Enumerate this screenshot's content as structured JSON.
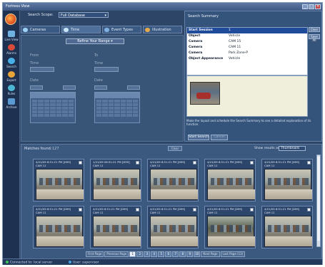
{
  "window": {
    "title": "Fortress View"
  },
  "sidebar": {
    "items": [
      {
        "label": "Live View",
        "icon": "monitor-icon",
        "color": "#6fb2e0"
      },
      {
        "label": "Alarms",
        "icon": "alarm-icon",
        "color": "#d94a3a"
      },
      {
        "label": "Search",
        "icon": "search-icon",
        "color": "#4ab0e8"
      },
      {
        "label": "Export",
        "icon": "export-icon",
        "color": "#e8a43a"
      },
      {
        "label": "Rules",
        "icon": "rules-icon",
        "color": "#4bb5d4"
      },
      {
        "label": "Archive",
        "icon": "archive-icon",
        "color": "#5a9ad0"
      }
    ]
  },
  "search": {
    "label": "Search Scope:",
    "value": "Full Database"
  },
  "tabs": [
    {
      "label": "Cameras"
    },
    {
      "label": "Time"
    },
    {
      "label": "Event Types"
    },
    {
      "label": "Illustration"
    }
  ],
  "searchpanel": {
    "refine_label": "Refine Your Range ▾",
    "from_label": "From",
    "to_label": "To",
    "time_label": "Time",
    "date_label": "Date"
  },
  "summary": {
    "title": "Search Summary",
    "buttons": [
      "Clear",
      "Save All"
    ],
    "rows": [
      {
        "k": "Start Session",
        "v": "1"
      },
      {
        "k": "Object",
        "v": "Vehicle"
      },
      {
        "k": "Camera",
        "v": "CAM 15"
      },
      {
        "k": "Camera",
        "v": "CAM 11"
      },
      {
        "k": "Camera",
        "v": "Park Zone-P"
      },
      {
        "k": "Object Appearance",
        "v": "Vehicle"
      }
    ],
    "note": "Make the layout and schedule the Search Summary to see a detailed explanation of its function.",
    "search_button": "Start Search",
    "cancel_button": "Cancel"
  },
  "results": {
    "label": "Matches found:",
    "count": "127",
    "mid_button": "Clear",
    "show_label": "Show results as",
    "show_value": "Thumbnails",
    "cards": [
      {
        "caption": "4/21/09 6:51:21 PM [D99]",
        "cam": "CAM 11"
      },
      {
        "caption": "1/21/09 06:51:21 PM [D99]",
        "cam": "CAM 11"
      },
      {
        "caption": "4/21/09 6:51:21 PM [D99]",
        "cam": "CAM 11"
      },
      {
        "caption": "4/21/09 6:51:21 PM [D99]",
        "cam": "CAM 11"
      },
      {
        "caption": "4/21/09 6:51:21 PM [D99]",
        "cam": "CAM 11"
      },
      {
        "caption": "4/21/09 6:51:21 PM [D99]",
        "cam": "CAM 11"
      },
      {
        "caption": "4/21/09 6:51:21 PM [D99]",
        "cam": "CAM 11"
      },
      {
        "caption": "4/21/09 6:51:21 PM [D99]",
        "cam": "CAM 11"
      },
      {
        "caption": "4/21/09 6:51:21 PM [D99]",
        "cam": "CAM 11"
      },
      {
        "caption": "4/21/09 6:51:21 PM [D99]",
        "cam": "CAM 11"
      }
    ],
    "pager": {
      "first": "First Page",
      "prev": "Previous Page",
      "pages": [
        "1",
        "2",
        "3",
        "4",
        "5",
        "6",
        "7",
        "8",
        "9",
        "10"
      ],
      "current": "1",
      "next": "Next Page",
      "last": "Last Page (13)"
    }
  },
  "status": {
    "connection": "Connected to: local server",
    "user": "User: supervisor"
  }
}
